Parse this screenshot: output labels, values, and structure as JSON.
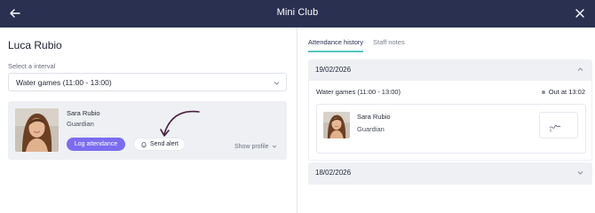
{
  "header": {
    "title": "Mini Club",
    "back_icon": "arrow-left-icon",
    "close_icon": "close-icon",
    "background": "#2a3050"
  },
  "left": {
    "person_name": "Luca Rubio",
    "interval_label": "Select a interval",
    "interval_value": "Water games (11:00 - 13:00)",
    "guardian": {
      "name": "Sara Rubio",
      "role": "Guardian"
    },
    "log_attendance_label": "Log attendance",
    "send_alert_label": "Send alert",
    "show_profile_label": "Show profile",
    "accent": "#7b6cf0"
  },
  "right": {
    "tabs": [
      {
        "label": "Attendance history",
        "active": true
      },
      {
        "label": "Staff notes",
        "active": false
      }
    ],
    "days": [
      {
        "date": "19/02/2026",
        "expanded": true,
        "session": "Water games (11:00 - 13:00)",
        "status": "Out at 13:02",
        "guardian_name": "Sara Rubio",
        "guardian_role": "Guardian"
      },
      {
        "date": "18/02/2026",
        "expanded": false
      }
    ],
    "tab_accent": "#52c6c0"
  }
}
